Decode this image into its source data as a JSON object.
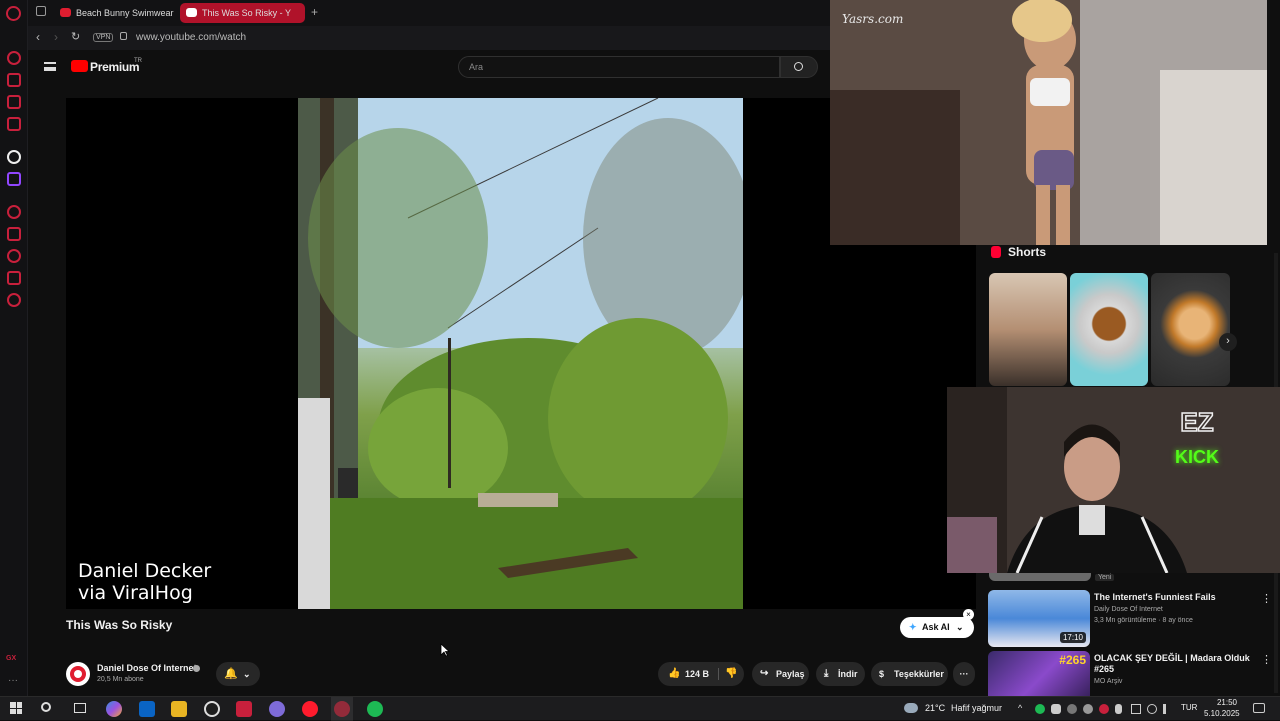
{
  "browser": {
    "tabs": [
      {
        "label": "Beach Bunny Swimwear F",
        "active": false
      },
      {
        "label": "This Was So Risky - Y",
        "active": true
      }
    ],
    "vpn_label": "VPN",
    "url": "www.youtube.com/watch"
  },
  "youtube": {
    "logo_text": "Premium",
    "logo_badge": "TR",
    "search_placeholder": "Ara"
  },
  "video": {
    "watermark_line1": "Daniel Decker",
    "watermark_line2": "via ViralHog",
    "title": "This Was So Risky",
    "channel_name": "Daniel Dose Of Internet",
    "subscriber_count": "20,5 Mn abone",
    "like_count": "124 B",
    "share_label": "Paylaş",
    "download_label": "İndir",
    "thanks_label": "Teşekkürler",
    "ask_ai_label": "Ask AI"
  },
  "overlay_top": {
    "logo_text": "Yasrs.com"
  },
  "shorts": {
    "title": "Shorts"
  },
  "recommendations": [
    {
      "title": "The Internet's Funniest Fails",
      "channel": "Daily Dose Of Internet",
      "meta": "3,3 Mn görüntüleme · 8 ay önce",
      "duration": "17:10",
      "badge": "Yeni"
    },
    {
      "title": "OLACAK ŞEY DEĞİL | Madara Olduk #265",
      "channel": "MO Arşiv",
      "meta": "",
      "duration": "",
      "badge": ""
    }
  ],
  "cam_overlay": {
    "sign_line1": "EZ",
    "sign_line2": "KICK"
  },
  "taskbar": {
    "temperature": "21°C",
    "weather": "Hafif yağmur",
    "language": "TUR",
    "time": "21:50",
    "date": "5.10.2025"
  },
  "colors": {
    "accent": "#e01d30",
    "yt_bg": "#0f0f0f",
    "button_bg": "#272727"
  }
}
